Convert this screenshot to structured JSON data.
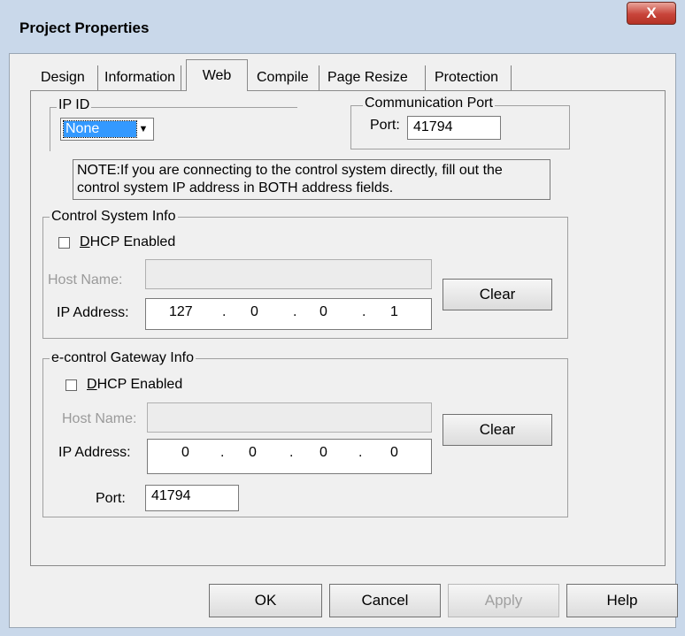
{
  "window": {
    "title": "Project Properties",
    "close_glyph": "X"
  },
  "tabs": [
    {
      "label": "Design"
    },
    {
      "label": "Information"
    },
    {
      "label": "Web"
    },
    {
      "label": "Compile"
    },
    {
      "label": "Page Resize"
    },
    {
      "label": "Protection"
    }
  ],
  "ipid": {
    "legend": "IP ID",
    "selected": "None"
  },
  "comm_port": {
    "legend": "Communication Port",
    "port_label": "Port:",
    "port_value": "41794"
  },
  "note": "NOTE:If you are connecting to the control system directly, fill out the control system IP address in BOTH address fields.",
  "control_system": {
    "legend": "Control System Info",
    "dhcp_first": "D",
    "dhcp_rest": "HCP Enabled",
    "host_label": "Host Name:",
    "host_value": "",
    "ip_label": "IP Address:",
    "ip": [
      "127",
      "0",
      "0",
      "1"
    ],
    "clear_label": "Clear"
  },
  "gateway": {
    "legend": "e-control Gateway Info",
    "dhcp_first": "D",
    "dhcp_rest": "HCP Enabled",
    "host_label": "Host Name:",
    "host_value": "",
    "ip_label": "IP Address:",
    "ip": [
      "0",
      "0",
      "0",
      "0"
    ],
    "clear_label": "Clear",
    "port_label": "Port:",
    "port_value": "41794"
  },
  "ip_separator": ".",
  "buttons": {
    "ok": "OK",
    "cancel": "Cancel",
    "apply": "Apply",
    "help": "Help"
  },
  "icons": {
    "close": "close-icon",
    "dropdown": "chevron-down-icon"
  }
}
